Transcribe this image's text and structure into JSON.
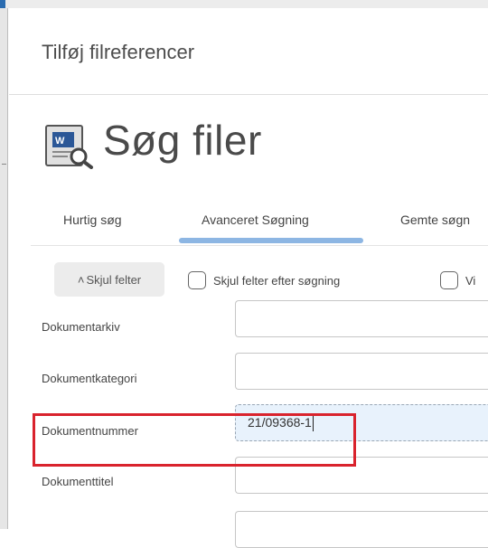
{
  "dialog": {
    "title": "Tilføj filreferencer"
  },
  "page": {
    "title": "Søg filer",
    "icon": "word-document-search-icon"
  },
  "tabs": [
    {
      "label": "Hurtig søg",
      "active": false
    },
    {
      "label": "Avanceret Søgning",
      "active": true
    },
    {
      "label": "Gemte søgn",
      "active": false
    }
  ],
  "toolbar": {
    "hide_fields_label": "Skjul felter",
    "hide_fields_icon": "double-chevron-up-icon",
    "hide_after_search_label": "Skjul felter efter søgning",
    "hide_after_search_checked": false,
    "third_option_label": "Vi",
    "third_option_checked": false
  },
  "fields": [
    {
      "label": "Dokumentarkiv",
      "value": ""
    },
    {
      "label": "Dokumentkategori",
      "value": ""
    },
    {
      "label": "Dokumentnummer",
      "value": "21/09368-1"
    },
    {
      "label": "Dokumenttitel",
      "value": ""
    }
  ],
  "colors": {
    "tab_underline": "#8db6e3",
    "highlight_box": "#d9232d",
    "filled_field_bg": "#e8f2fc",
    "word_icon_blue": "#2b5797"
  }
}
